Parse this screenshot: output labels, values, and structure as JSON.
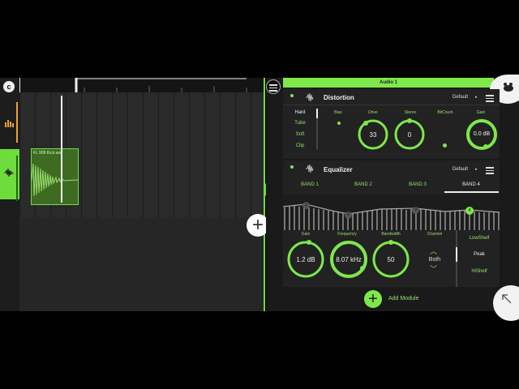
{
  "arrangement": {
    "clip_name": "FL 909 Kick.wav"
  },
  "plugin": {
    "track_name": "Audio 1",
    "distortion": {
      "title": "Distortion",
      "preset": "Default",
      "modes": [
        "Hard",
        "Tube",
        "Soft",
        "Clip"
      ],
      "selected_mode": "Hard",
      "labels": {
        "bias": "Bias",
        "drive": "Drive",
        "stereo": "Stereo",
        "bitcrush": "BitCrush",
        "gain": "Gain"
      },
      "drive_value": "33",
      "stereo_value": "0",
      "gain_value": "0.0 dB"
    },
    "equalizer": {
      "title": "Equalizer",
      "preset": "Default",
      "bands": [
        "BAND 1",
        "BAND 2",
        "BAND 3",
        "BAND 4"
      ],
      "active_band": "BAND 4",
      "band_markers": [
        "1",
        "2",
        "3",
        "4"
      ],
      "labels": {
        "gain": "Gain",
        "frequency": "Frequency",
        "bandwidth": "Bandwidth",
        "channel": "Channel"
      },
      "gain_value": "1.2 dB",
      "frequency_value": "8.07 kHz",
      "bandwidth_value": "50",
      "channel_value": "Both",
      "filter_types": [
        "LowShelf",
        "Peak",
        "HiShelf"
      ],
      "selected_filter": "Peak"
    },
    "add_module_label": "Add Module"
  },
  "colors": {
    "accent": "#7ee84b",
    "panel": "#222222",
    "background": "#1a1a1a"
  }
}
